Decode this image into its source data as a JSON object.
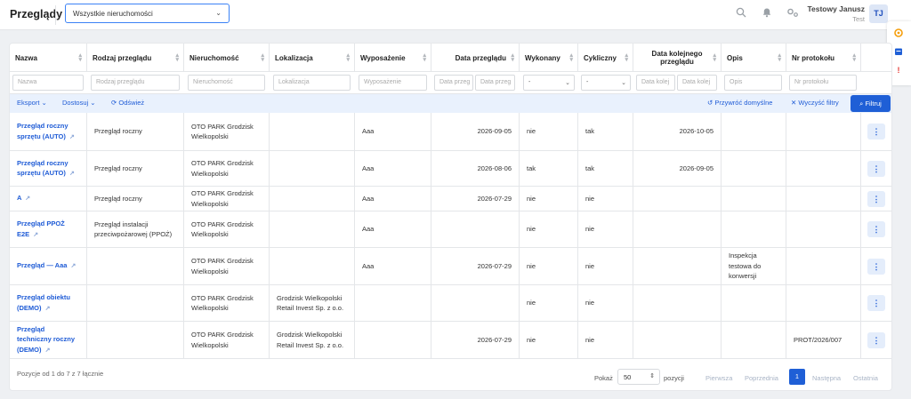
{
  "header": {
    "title": "Przeglądy",
    "property_filter": "Wszystkie nieruchomości",
    "user_name": "Testowy Janusz",
    "user_role": "Test",
    "avatar_initials": "TJ"
  },
  "columns": [
    "Nazwa",
    "Rodzaj przeglądu",
    "Nieruchomość",
    "Lokalizacja",
    "Wyposażenie",
    "Data przeglądu",
    "Wykonany",
    "Cykliczny",
    "Data kolejnego przeglądu",
    "Opis",
    "Nr protokołu"
  ],
  "filters": {
    "nazwa": "Nazwa",
    "rodzaj": "Rodzaj przeglądu",
    "nieruchomosc": "Nieruchomość",
    "lokalizacja": "Lokalizacja",
    "wyposazenie": "Wyposażenie",
    "data_od": "Data przeg",
    "data_do": "Data przeg",
    "wykonany": "-",
    "cykliczny": "-",
    "data_kol_od": "Data kolej",
    "data_kol_do": "Data kolej",
    "opis": "Opis",
    "nr_protokolu": "Nr protokołu"
  },
  "toolbar": {
    "export": "Eksport",
    "customize": "Dostosuj",
    "refresh": "Odśwież",
    "restore": "Przywróć domyślne",
    "clear": "Wyczyść filtry",
    "filter": "Filtruj"
  },
  "rows": [
    {
      "name": "Przegląd roczny sprzętu (AUTO)",
      "type": "Przegląd roczny",
      "property": "OTO PARK Grodzisk Wielkopolski",
      "location": "",
      "equipment": "Aaa",
      "date": "2026-09-05",
      "done": "nie",
      "cyclic": "tak",
      "next_date": "2026-10-05",
      "description": "",
      "protocol": ""
    },
    {
      "name": "Przegląd roczny sprzętu (AUTO)",
      "type": "Przegląd roczny",
      "property": "OTO PARK Grodzisk Wielkopolski",
      "location": "",
      "equipment": "Aaa",
      "date": "2026-08-06",
      "done": "tak",
      "cyclic": "tak",
      "next_date": "2026-09-05",
      "description": "",
      "protocol": ""
    },
    {
      "name": "A",
      "type": "Przegląd roczny",
      "property": "OTO PARK Grodzisk Wielkopolski",
      "location": "",
      "equipment": "Aaa",
      "date": "2026-07-29",
      "done": "nie",
      "cyclic": "nie",
      "next_date": "",
      "description": "",
      "protocol": ""
    },
    {
      "name": "Przegląd PPOŻ E2E",
      "type": "Przegląd instalacji przeciwpożarowej (PPOŻ)",
      "property": "OTO PARK Grodzisk Wielkopolski",
      "location": "",
      "equipment": "Aaa",
      "date": "",
      "done": "nie",
      "cyclic": "nie",
      "next_date": "",
      "description": "",
      "protocol": ""
    },
    {
      "name": "Przegląd — Aaa",
      "type": "",
      "property": "OTO PARK Grodzisk Wielkopolski",
      "location": "",
      "equipment": "Aaa",
      "date": "2026-07-29",
      "done": "nie",
      "cyclic": "nie",
      "next_date": "",
      "description": "Inspekcja testowa do konwersji",
      "protocol": ""
    },
    {
      "name": "Przegląd obiektu (DEMO)",
      "type": "",
      "property": "OTO PARK Grodzisk Wielkopolski",
      "location": "Grodzisk Wielkopolski Retail Invest Sp. z o.o.",
      "equipment": "",
      "date": "",
      "done": "nie",
      "cyclic": "nie",
      "next_date": "",
      "description": "",
      "protocol": ""
    },
    {
      "name": "Przegląd techniczny roczny (DEMO)",
      "type": "",
      "property": "OTO PARK Grodzisk Wielkopolski",
      "location": "Grodzisk Wielkopolski Retail Invest Sp. z o.o.",
      "equipment": "",
      "date": "2026-07-29",
      "done": "nie",
      "cyclic": "nie",
      "next_date": "",
      "description": "",
      "protocol": "PROT/2026/007"
    }
  ],
  "footer": {
    "info": "Pozycje od 1 do 7 z 7 łącznie",
    "show_label": "Pokaż",
    "page_size": "50",
    "items_label": "pozycji",
    "first": "Pierwsza",
    "prev": "Poprzednia",
    "current": "1",
    "next": "Następna",
    "last": "Ostatnia"
  },
  "colors": {
    "accent": "#1f5fd6",
    "toolbar_bg": "#e9f1fd",
    "link": "#1e5bd6"
  }
}
